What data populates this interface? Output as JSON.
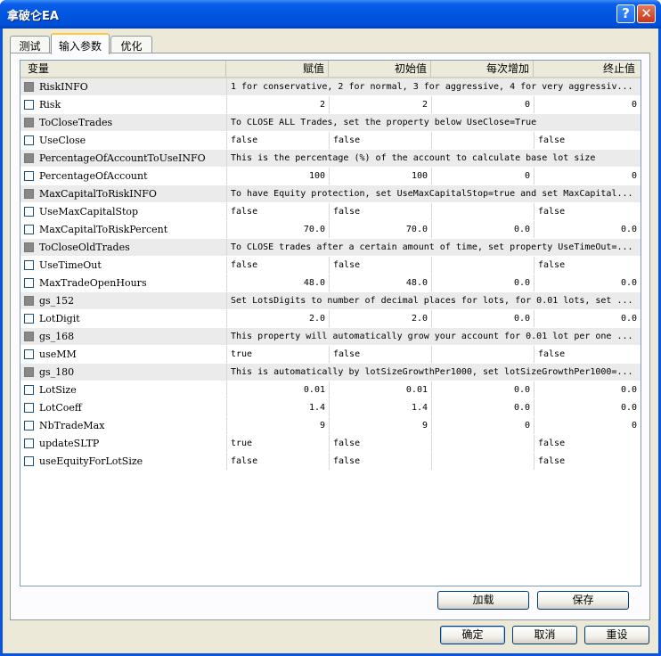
{
  "window": {
    "title": "拿破仑EA",
    "help_glyph": "?",
    "close_glyph": "✕"
  },
  "tabs": [
    {
      "label": "测试"
    },
    {
      "label": "输入参数"
    },
    {
      "label": "优化"
    }
  ],
  "active_tab": "输入参数",
  "columns": [
    "变量",
    "赋值",
    "初始值",
    "每次增加",
    "终止值"
  ],
  "rows": [
    {
      "type": "info",
      "name": "RiskINFO",
      "desc": "1 for conservative, 2 for normal, 3 for aggressive, 4 for very aggressiv..."
    },
    {
      "type": "num",
      "name": "Risk",
      "value": "2",
      "start": "2",
      "step": "0",
      "stop": "0"
    },
    {
      "type": "info",
      "name": "ToCloseTrades",
      "desc": "To CLOSE ALL Trades, set the property below UseClose=True"
    },
    {
      "type": "bool",
      "name": "UseClose",
      "value": "false",
      "start": "false",
      "step": "",
      "stop": "false"
    },
    {
      "type": "info",
      "name": "PercentageOfAccountToUseINFO",
      "desc": "This is the percentage (%) of the account to calculate base lot size"
    },
    {
      "type": "num",
      "name": "PercentageOfAccount",
      "value": "100",
      "start": "100",
      "step": "0",
      "stop": "0"
    },
    {
      "type": "info",
      "name": "MaxCapitalToRiskINFO",
      "desc": "To have Equity protection, set UseMaxCapitalStop=true and set MaxCapital..."
    },
    {
      "type": "bool",
      "name": "UseMaxCapitalStop",
      "value": "false",
      "start": "false",
      "step": "",
      "stop": "false"
    },
    {
      "type": "num",
      "name": "MaxCapitalToRiskPercent",
      "value": "70.0",
      "start": "70.0",
      "step": "0.0",
      "stop": "0.0"
    },
    {
      "type": "info",
      "name": "ToCloseOldTrades",
      "desc": "To CLOSE trades after a certain amount of time, set property UseTimeOut=..."
    },
    {
      "type": "bool",
      "name": "UseTimeOut",
      "value": "false",
      "start": "false",
      "step": "",
      "stop": "false"
    },
    {
      "type": "num",
      "name": "MaxTradeOpenHours",
      "value": "48.0",
      "start": "48.0",
      "step": "0.0",
      "stop": "0.0"
    },
    {
      "type": "info",
      "name": "gs_152",
      "desc": "Set LotsDigits to number of decimal places for lots, for 0.01 lots, set ..."
    },
    {
      "type": "num",
      "name": "LotDigit",
      "value": "2.0",
      "start": "2.0",
      "step": "0.0",
      "stop": "0.0"
    },
    {
      "type": "info",
      "name": "gs_168",
      "desc": "This property will automatically grow your account for 0.01 lot per one ..."
    },
    {
      "type": "bool",
      "name": "useMM",
      "value": "true",
      "start": "false",
      "step": "",
      "stop": "false"
    },
    {
      "type": "info",
      "name": "gs_180",
      "desc": "This is automatically by lotSizeGrowthPer1000, set lotSizeGrowthPer1000=..."
    },
    {
      "type": "num",
      "name": "LotSize",
      "value": "0.01",
      "start": "0.01",
      "step": "0.0",
      "stop": "0.0"
    },
    {
      "type": "num",
      "name": "LotCoeff",
      "value": "1.4",
      "start": "1.4",
      "step": "0.0",
      "stop": "0.0"
    },
    {
      "type": "num",
      "name": "NbTradeMax",
      "value": "9",
      "start": "9",
      "step": "0",
      "stop": "0"
    },
    {
      "type": "bool",
      "name": "updateSLTP",
      "value": "true",
      "start": "false",
      "step": "",
      "stop": "false"
    },
    {
      "type": "bool",
      "name": "useEquityForLotSize",
      "value": "false",
      "start": "false",
      "step": "",
      "stop": "false"
    }
  ],
  "panel_buttons": {
    "load": "加载",
    "save": "保存"
  },
  "dialog_buttons": {
    "ok": "确定",
    "cancel": "取消",
    "reset": "重设"
  }
}
